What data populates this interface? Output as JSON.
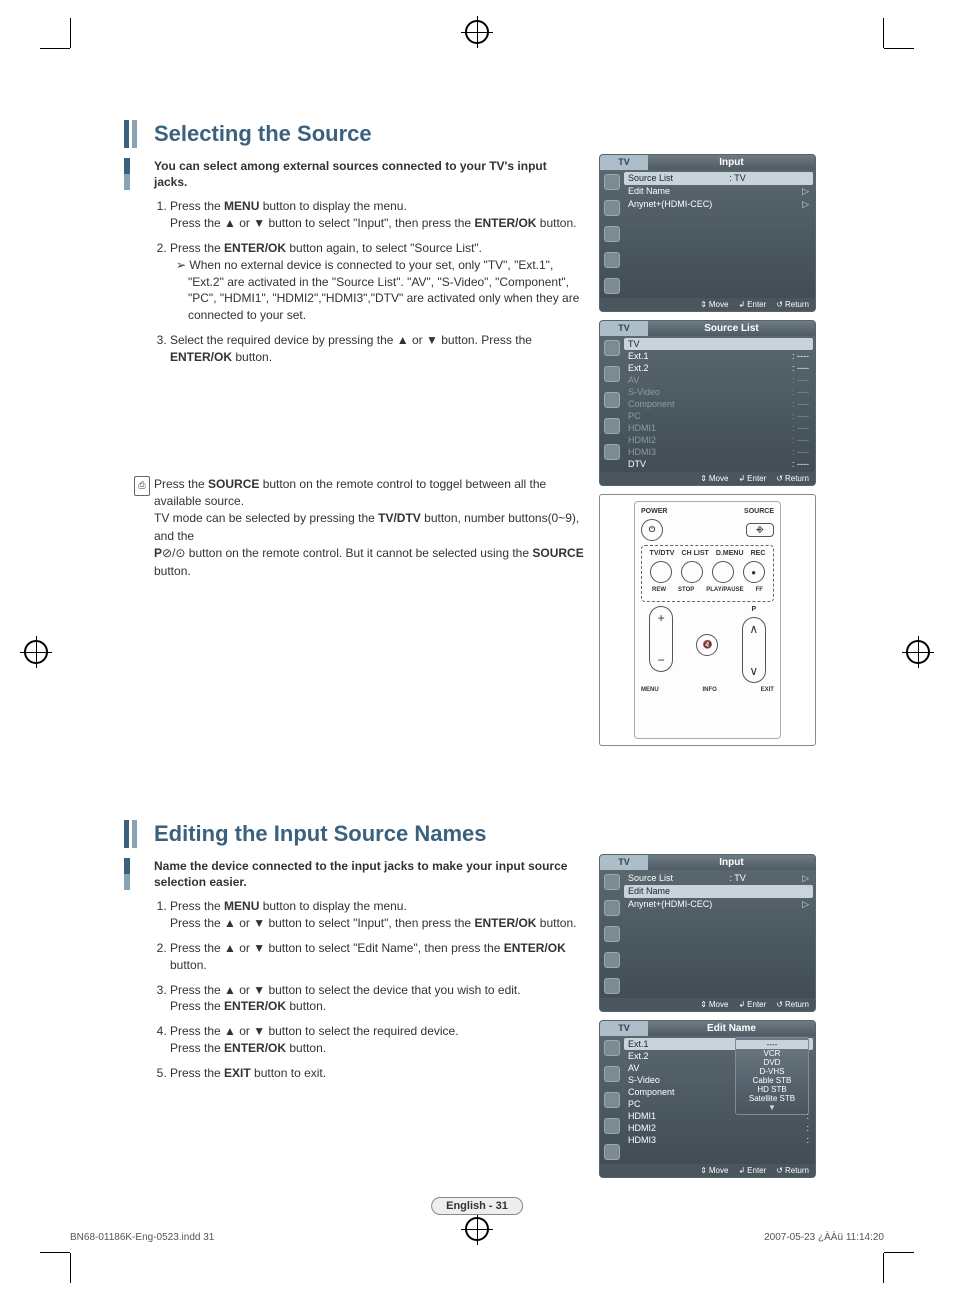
{
  "section1": {
    "title": "Selecting the Source",
    "intro": "You can select among external sources connected to your TV's input jacks.",
    "steps": [
      "Press the <b>MENU</b> button to display the menu.<br>Press the ▲ or ▼ button to select \"Input\", then press the <b>ENTER/OK</b> button.",
      "Press the <b>ENTER/OK</b> button again, to select \"Source List\".",
      "Select the required device by pressing the ▲ or ▼ button. Press the <b>ENTER/OK</b> button."
    ],
    "step2_sub": "When no external device is connected to your set, only \"TV\", \"Ext.1\", \"Ext.2\" are activated in the \"Source List\". \"AV\", \"S-Video\", \"Component\", \"PC\", \"HDMI1\", \"HDMI2\",\"HDMI3\",\"DTV\" are activated only when they are connected to your set.",
    "tip": "Press the <b>SOURCE</b> button on the remote control to toggel between all the available source.<br>TV mode can be selected by pressing the <b>TV/DTV</b> button, number buttons(0~9), and the<br><b>P</b>⊘/⊙ button on the remote control. But it cannot be selected using the <b>SOURCE</b> button."
  },
  "section2": {
    "title": "Editing the Input Source Names",
    "intro": "Name the device connected to the input jacks to make your input source selection easier.",
    "steps": [
      "Press the <b>MENU</b> button to display the menu.<br>Press the ▲ or ▼ button to select \"Input\", then press the <b>ENTER/OK</b> button.",
      "Press the ▲ or ▼ button to select \"Edit Name\", then press the <b>ENTER/OK</b> button.",
      "Press the ▲ or ▼ button to select the device that you wish to edit.<br>Press the <b>ENTER/OK</b> button.",
      "Press the ▲ or ▼ button to select the required device.<br>Press the <b>ENTER/OK</b> button.",
      "Press the <b>EXIT</b> button to exit."
    ]
  },
  "osd_input": {
    "tab": "TV",
    "title": "Input",
    "rows": [
      {
        "label": "Source List",
        "value": ": TV",
        "sel": true,
        "arrow": "▷"
      },
      {
        "label": "Edit Name",
        "value": "",
        "sel": false,
        "arrow": "▷"
      },
      {
        "label": "Anynet+(HDMI-CEC)",
        "value": "",
        "sel": false,
        "arrow": "▷"
      }
    ],
    "foot": {
      "move": "Move",
      "enter": "Enter",
      "return": "Return"
    }
  },
  "osd_sourcelist": {
    "tab": "TV",
    "title": "Source List",
    "rows": [
      {
        "label": "TV",
        "value": "",
        "sel": true,
        "dim": false
      },
      {
        "label": "Ext.1",
        "value": ": ----",
        "dim": false
      },
      {
        "label": "Ext.2",
        "value": ": ----",
        "dim": false
      },
      {
        "label": "AV",
        "value": ": ----",
        "dim": true
      },
      {
        "label": "S-Video",
        "value": ": ----",
        "dim": true
      },
      {
        "label": "Component",
        "value": ": ----",
        "dim": true
      },
      {
        "label": "PC",
        "value": ": ----",
        "dim": true
      },
      {
        "label": "HDMI1",
        "value": ": ----",
        "dim": true
      },
      {
        "label": "HDMI2",
        "value": ": ----",
        "dim": true
      },
      {
        "label": "HDMI3",
        "value": ": ----",
        "dim": true
      },
      {
        "label": "DTV",
        "value": ": ----",
        "dim": false
      }
    ],
    "foot": {
      "move": "Move",
      "enter": "Enter",
      "return": "Return"
    }
  },
  "osd_input2": {
    "tab": "TV",
    "title": "Input",
    "rows": [
      {
        "label": "Source List",
        "value": ": TV",
        "sel": false,
        "arrow": "▷"
      },
      {
        "label": "Edit Name",
        "value": "",
        "sel": true,
        "arrow": "▷"
      },
      {
        "label": "Anynet+(HDMI-CEC)",
        "value": "",
        "sel": false,
        "arrow": "▷"
      }
    ],
    "foot": {
      "move": "Move",
      "enter": "Enter",
      "return": "Return"
    }
  },
  "osd_editname": {
    "tab": "TV",
    "title": "Edit Name",
    "rows": [
      {
        "label": "Ext.1",
        "value": ":",
        "sel": true
      },
      {
        "label": "Ext.2",
        "value": ":"
      },
      {
        "label": "AV",
        "value": ":"
      },
      {
        "label": "S-Video",
        "value": ":"
      },
      {
        "label": "Component",
        "value": ":"
      },
      {
        "label": "PC",
        "value": ":"
      },
      {
        "label": "HDMI1",
        "value": ":"
      },
      {
        "label": "HDMI2",
        "value": ":"
      },
      {
        "label": "HDMI3",
        "value": ":"
      }
    ],
    "popup": [
      "----",
      "VCR",
      "DVD",
      "D-VHS",
      "Cable STB",
      "HD STB",
      "Satellite STB",
      "▼"
    ],
    "popup_sel": 0,
    "foot": {
      "move": "Move",
      "enter": "Enter",
      "return": "Return"
    }
  },
  "remote": {
    "power": "POWER",
    "source": "SOURCE",
    "row2": [
      "TV/DTV",
      "CH LIST",
      "D.MENU",
      "REC"
    ],
    "row3": [
      "REW",
      "STOP",
      "PLAY/PAUSE",
      "FF"
    ],
    "p_label": "P",
    "mute_label": "MUTE",
    "menu_label": "MENU",
    "exit_label": "EXIT",
    "info_label": "INFO"
  },
  "page_badge": "English - 31",
  "footer": {
    "left": "BN68-01186K-Eng-0523.indd   31",
    "right": "2007-05-23   ¿ÀÀü 11:14:20"
  }
}
